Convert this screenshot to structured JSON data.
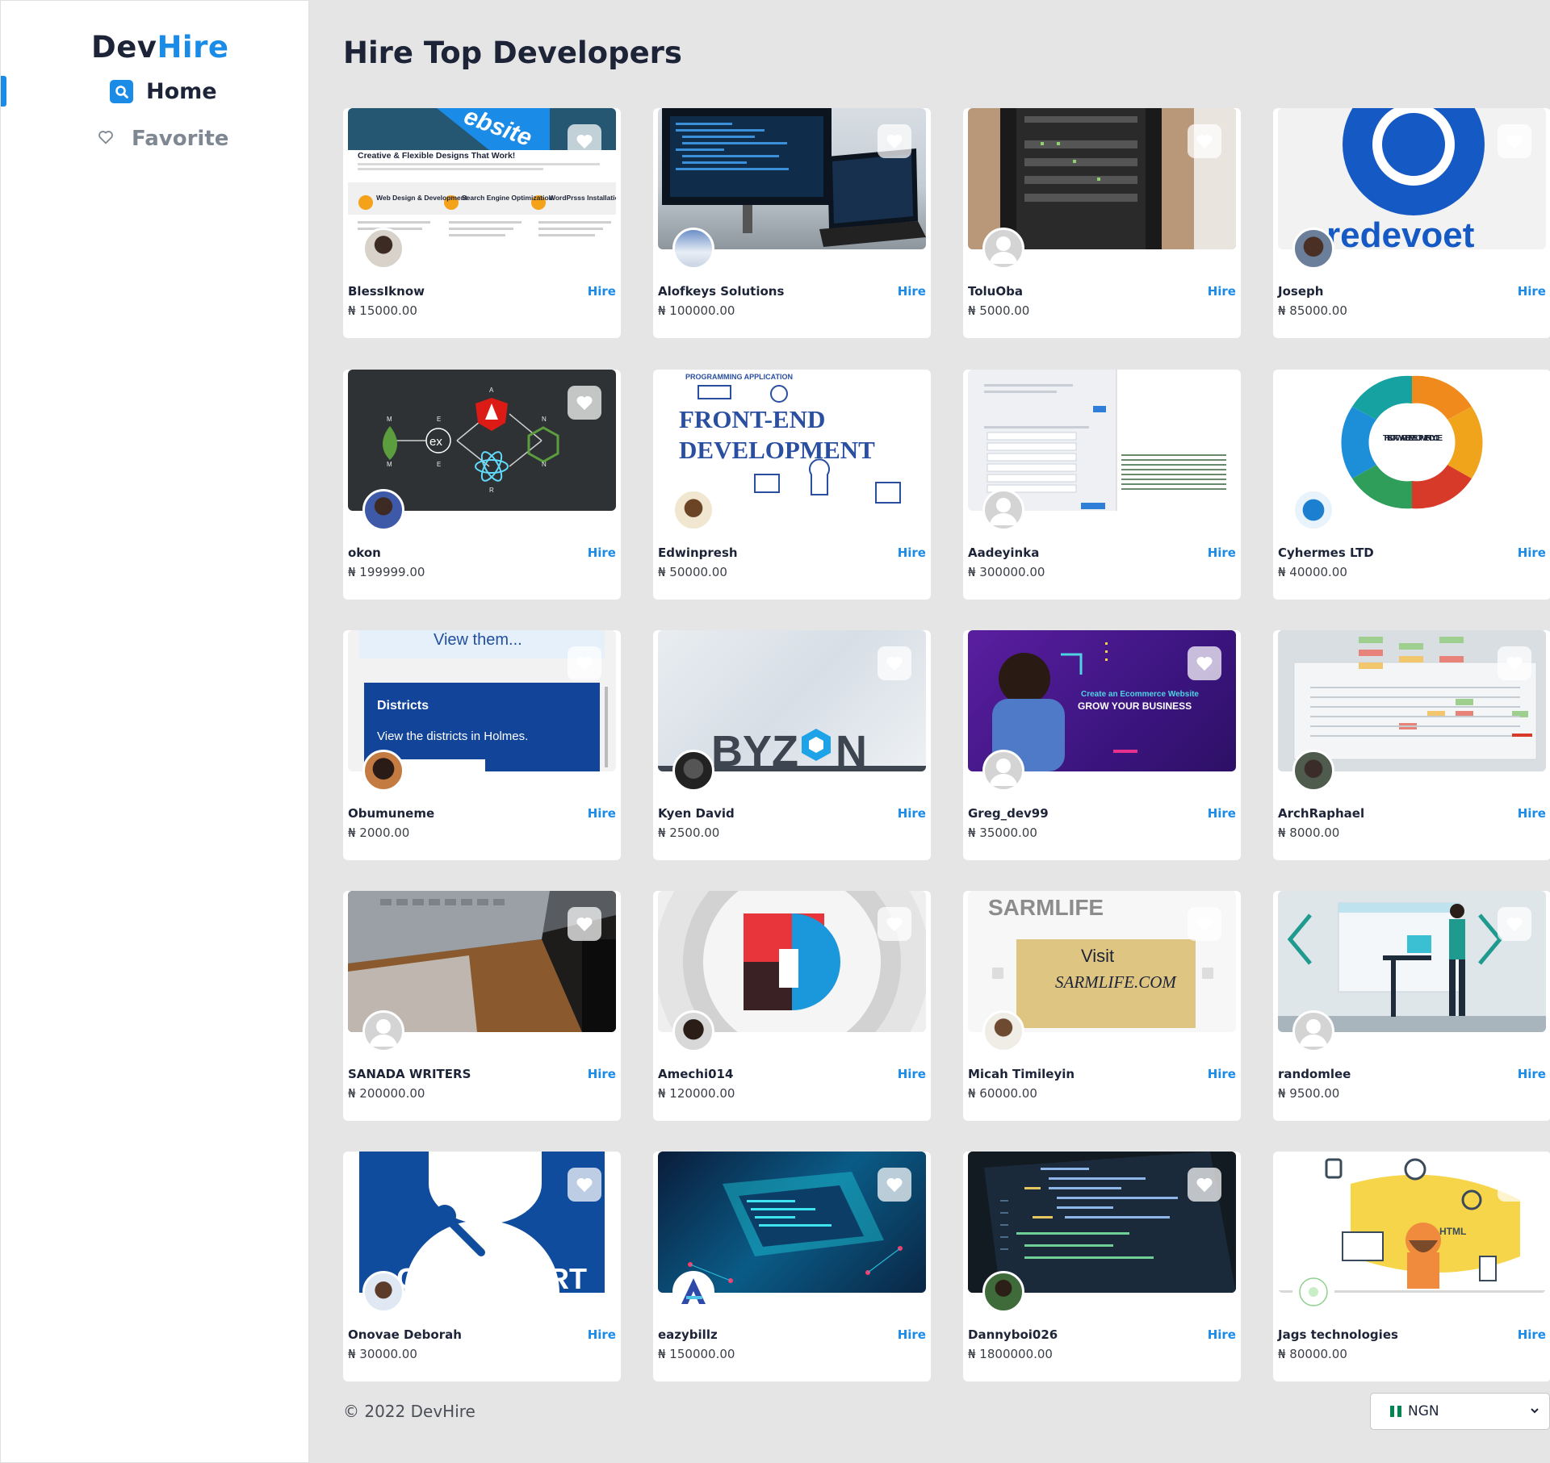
{
  "app": {
    "logo_part1": "Dev",
    "logo_part2": "Hire"
  },
  "nav": {
    "home": "Home",
    "favorite": "Favorite"
  },
  "page": {
    "title": "Hire Top Developers"
  },
  "hire_label": "Hire",
  "developers": [
    {
      "name": "BlessIknow",
      "price": "₦ 15000.00"
    },
    {
      "name": "Alofkeys Solutions",
      "price": "₦ 100000.00"
    },
    {
      "name": "ToluOba",
      "price": "₦ 5000.00"
    },
    {
      "name": "Joseph",
      "price": "₦ 85000.00"
    },
    {
      "name": "okon",
      "price": "₦ 199999.00"
    },
    {
      "name": "Edwinpresh",
      "price": "₦ 50000.00"
    },
    {
      "name": "Aadeyinka",
      "price": "₦ 300000.00"
    },
    {
      "name": "Cyhermes LTD",
      "price": "₦ 40000.00"
    },
    {
      "name": "Obumuneme",
      "price": "₦ 2000.00"
    },
    {
      "name": "Kyen David",
      "price": "₦ 2500.00"
    },
    {
      "name": "Greg_dev99",
      "price": "₦ 35000.00"
    },
    {
      "name": "ArchRaphael",
      "price": "₦ 8000.00"
    },
    {
      "name": "SANADA WRITERS",
      "price": "₦ 200000.00"
    },
    {
      "name": "Amechi014",
      "price": "₦ 120000.00"
    },
    {
      "name": "Micah Timileyin",
      "price": "₦ 60000.00"
    },
    {
      "name": "randomlee",
      "price": "₦ 9500.00"
    },
    {
      "name": "Onovae Deborah",
      "price": "₦ 30000.00"
    },
    {
      "name": "eazybillz",
      "price": "₦ 150000.00"
    },
    {
      "name": "Dannyboi026",
      "price": "₦ 1800000.00"
    },
    {
      "name": "Jags technologies",
      "price": "₦ 80000.00"
    }
  ],
  "image_text": {
    "c0_banner": "ebsite",
    "c0_headline": "Creative & Flexible Designs That Work!",
    "c0_f1": "Web Design & Development",
    "c0_f2": "Search Engine Optimization",
    "c0_f3": "WordPrsss Installation",
    "c3_logo": "redevoet",
    "c4_ex": "ex",
    "c5_line1": "FRONT-END",
    "c5_line2": "DEVELOPMENT",
    "c5_top": "PROGRAMMING    APPLICATION",
    "c7_center": "THE SOFTWARE DEVELOPMENT CYCLE",
    "c8_view": "View them...",
    "c8_title": "Districts",
    "c8_body": "View the districts in Holmes.",
    "c9_logo_a": "BYZ",
    "c9_logo_b": "N",
    "c10_small": "Create an Ecommerce Website",
    "c10_big": "GROW YOUR BUSINESS",
    "c14_brand": "SARMLIFE",
    "c14_visit": "Visit",
    "c14_url": "SARMLIFE.COM",
    "c16_text": "CH SUPPORT",
    "c19_html": "HTML"
  },
  "footer": {
    "copyright": "© 2022 DevHire",
    "currency": "NGN"
  },
  "colors": {
    "accent": "#1b8be8",
    "text": "#1d2438",
    "background": "#e5e5e5",
    "ngn_flag_green": "#008751"
  }
}
